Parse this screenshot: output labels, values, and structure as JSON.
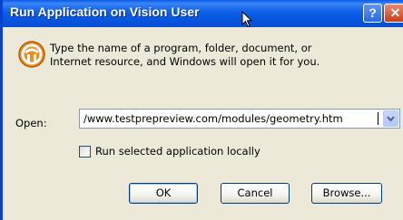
{
  "window": {
    "title": "Run Application on Vision User",
    "help_glyph": "?",
    "close_glyph": "✕"
  },
  "dialog": {
    "description_line1": "Type the name of a program, folder, document, or",
    "description_line2": "Internet resource, and Windows will open it for you.",
    "icon": "run-icon"
  },
  "open_field": {
    "label": "Open:",
    "value": "/www.testprepreview.com/modules/geometry.htm"
  },
  "run_locally": {
    "label": "Run selected application locally",
    "checked": false
  },
  "buttons": {
    "ok": "OK",
    "cancel": "Cancel",
    "browse": "Browse..."
  },
  "colors": {
    "titlebar": "#0a5fe6",
    "dialog_bg": "#ece9d8",
    "close_red": "#c7401d",
    "run_icon_orange": "#f08a1c"
  }
}
